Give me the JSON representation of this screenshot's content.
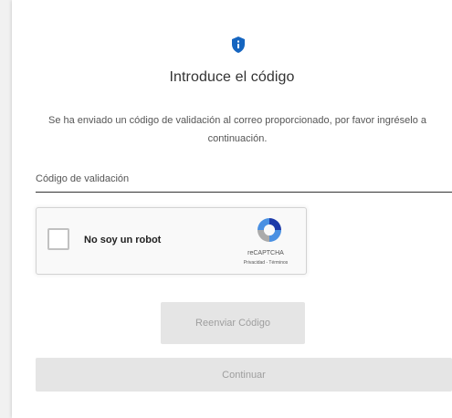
{
  "dialog": {
    "title": "Introduce el código",
    "description": "Se ha enviado un código de validación al correo proporcionado, por favor ingréselo a continuación.",
    "icon": "shield-icon",
    "accent_color": "#1565c0"
  },
  "code_field": {
    "placeholder": "Código de validación",
    "value": ""
  },
  "recaptcha": {
    "label": "No soy un robot",
    "checked": false,
    "brand": "reCAPTCHA",
    "links": "Privacidad - Términos",
    "icon": "recaptcha-logo-icon"
  },
  "buttons": {
    "resend_label": "Reenviar Código",
    "continue_label": "Continuar",
    "disabled_bg": "#e5e5e5",
    "disabled_text": "#9e9e9e"
  }
}
